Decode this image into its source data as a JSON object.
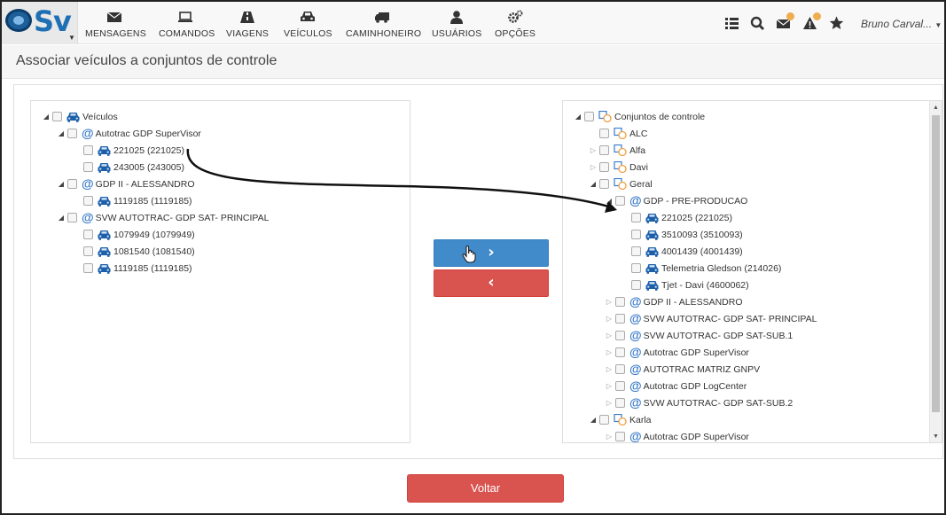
{
  "app": {
    "logo_text": "Sv"
  },
  "nav": {
    "items": [
      {
        "label": "MENSAGENS",
        "icon": "envelope-icon"
      },
      {
        "label": "COMANDOS",
        "icon": "laptop-icon"
      },
      {
        "label": "VIAGENS",
        "icon": "road-icon"
      },
      {
        "label": "VEÍCULOS",
        "icon": "car-icon"
      },
      {
        "label": "CAMINHONEIRO",
        "icon": "truck-icon"
      },
      {
        "label": "USUÁRIOS",
        "icon": "user-icon"
      },
      {
        "label": "OPÇÕES",
        "icon": "gears-icon"
      }
    ],
    "user": "Bruno Carval..."
  },
  "page": {
    "title": "Associar veículos a conjuntos de controle"
  },
  "left_tree": {
    "root": "Veículos",
    "groups": [
      {
        "label": "Autotrac GDP SuperVisor",
        "items": [
          "221025 (221025)",
          "243005 (243005)"
        ]
      },
      {
        "label": "GDP II - ALESSANDRO",
        "items": [
          "1119185 (1119185)"
        ]
      },
      {
        "label": "SVW AUTOTRAC- GDP SAT- PRINCIPAL",
        "items": [
          "1079949 (1079949)",
          "1081540 (1081540)",
          "1119185 (1119185)"
        ]
      }
    ]
  },
  "right_tree": {
    "root": "Conjuntos de controle",
    "sets": [
      "ALC",
      "Alfa",
      "Davi",
      "Geral"
    ],
    "geral_group": "GDP - PRE-PRODUCAO",
    "geral_items": [
      "221025 (221025)",
      "3510093 (3510093)",
      "4001439 (4001439)",
      "Telemetria Gledson (214026)",
      "Tjet - Davi (4600062)"
    ],
    "geral_other_groups": [
      "GDP II - ALESSANDRO",
      "SVW AUTOTRAC- GDP SAT- PRINCIPAL",
      "SVW AUTOTRAC- GDP SAT-SUB.1",
      "Autotrac GDP SuperVisor",
      "AUTOTRAC MATRIZ GNPV",
      "Autotrac GDP LogCenter",
      "SVW AUTOTRAC- GDP SAT-SUB.2"
    ],
    "karla": "Karla",
    "karla_group": "Autotrac GDP SuperVisor"
  },
  "buttons": {
    "add": "›",
    "remove": "‹",
    "back": "Voltar"
  },
  "colors": {
    "primary": "#428bca",
    "danger": "#d9534f",
    "accent_orange": "#f0ad4e"
  }
}
